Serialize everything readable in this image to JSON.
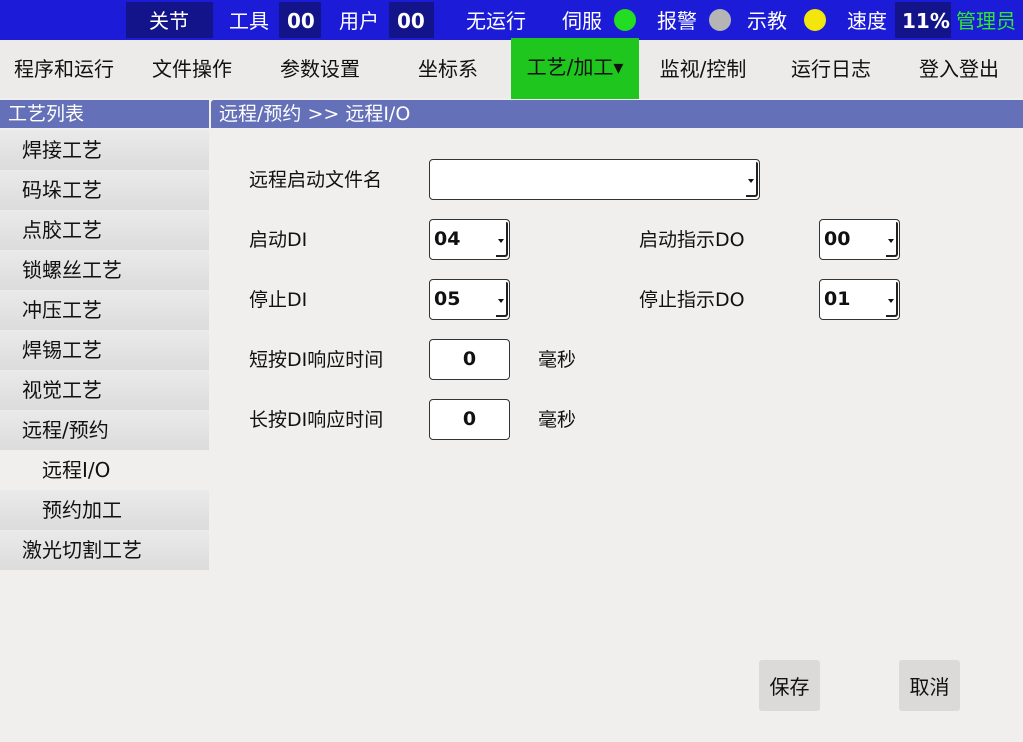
{
  "status": {
    "mode": "关节",
    "tool_label": "工具",
    "tool_value": "00",
    "user_label": "用户",
    "user_value": "00",
    "run_state": "无运行",
    "servo_label": "伺服",
    "servo_color": "#22dd22",
    "alarm_label": "报警",
    "alarm_color": "#b5b5b5",
    "teach_label": "示教",
    "teach_color": "#f2e60c",
    "speed_label": "速度",
    "speed_value": "11%",
    "role": "管理员",
    "role_color": "#2ee82e"
  },
  "menu": {
    "items": [
      {
        "label": "程序和运行"
      },
      {
        "label": "文件操作"
      },
      {
        "label": "参数设置"
      },
      {
        "label": "坐标系"
      },
      {
        "label": "工艺/加工▾",
        "active": true
      },
      {
        "label": "监视/控制"
      },
      {
        "label": "运行日志"
      },
      {
        "label": "登入登出"
      }
    ]
  },
  "sidebar": {
    "title": "工艺列表",
    "items": [
      {
        "label": "焊接工艺"
      },
      {
        "label": "码垛工艺"
      },
      {
        "label": "点胶工艺"
      },
      {
        "label": "锁螺丝工艺"
      },
      {
        "label": "冲压工艺"
      },
      {
        "label": "焊锡工艺"
      },
      {
        "label": "视觉工艺"
      },
      {
        "label": "远程/预约"
      },
      {
        "label": "远程I/O",
        "sub": true,
        "selected": true
      },
      {
        "label": "预约加工",
        "sub": true
      },
      {
        "label": "激光切割工艺"
      }
    ]
  },
  "breadcrumb": "远程/预约 >> 远程I/O",
  "form": {
    "file_label": "远程启动文件名",
    "file_value": "",
    "start_di_label": "启动DI",
    "start_di_value": "04",
    "start_do_label": "启动指示DO",
    "start_do_value": "00",
    "stop_di_label": "停止DI",
    "stop_di_value": "05",
    "stop_do_label": "停止指示DO",
    "stop_do_value": "01",
    "short_press_label": "短按DI响应时间",
    "short_press_value": "0",
    "short_press_unit": "毫秒",
    "long_press_label": "长按DI响应时间",
    "long_press_value": "0",
    "long_press_unit": "毫秒"
  },
  "buttons": {
    "save": "保存",
    "cancel": "取消"
  }
}
